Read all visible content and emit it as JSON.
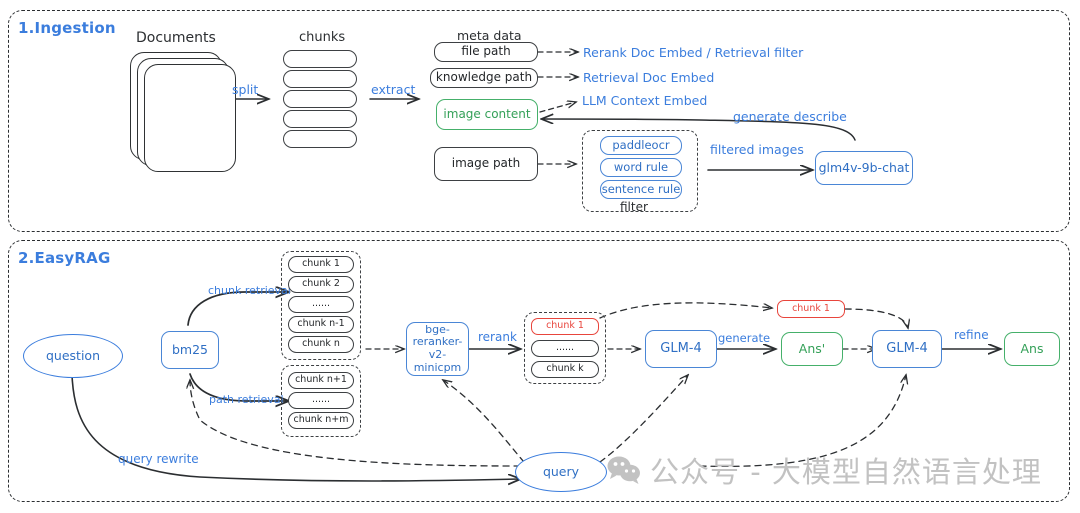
{
  "sections": [
    {
      "id": "ingestion",
      "title": "1.Ingestion"
    },
    {
      "id": "easyrag",
      "title": "2.EasyRAG"
    }
  ],
  "ingestion": {
    "group_labels": {
      "documents": "Documents",
      "chunks": "chunks",
      "meta_data": "meta data",
      "filter": "filter"
    },
    "arrow_labels": {
      "split": "split",
      "extract": "extract",
      "filtered_images": "filtered images",
      "generate_describe": "generate describe"
    },
    "meta_boxes": [
      {
        "label": "file path",
        "style": "gray"
      },
      {
        "label": "knowledge path",
        "style": "gray"
      },
      {
        "label": "image content",
        "style": "green"
      },
      {
        "label": "image path",
        "style": "gray"
      }
    ],
    "embed_targets": [
      "Rerank Doc Embed  / Retrieval filter",
      "Retrieval Doc Embed",
      "LLM Context Embed"
    ],
    "filter_rules": [
      "paddleocr",
      "word rule",
      "sentence rule"
    ],
    "vision_model": "glm4v-9b-chat"
  },
  "easyrag": {
    "question": "question",
    "bm25": "bm25",
    "reranker": "bge-\nreranker-v2-\nminicpm",
    "query": "query",
    "llm_generate": "GLM-4",
    "llm_refine": "GLM-4",
    "answer_draft": "Ans'",
    "answer_final": "Ans",
    "top_chunk": "chunk 1",
    "arrow_labels": {
      "chunk_retrieval": "chunk retrieval",
      "path_retrieval": "path retrieval",
      "rerank": "rerank",
      "generate": "generate",
      "refine": "refine",
      "query_rewrite": "query rewrite"
    },
    "chunk_group_top": [
      "chunk 1",
      "chunk 2",
      "......",
      "chunk n-1",
      "chunk n"
    ],
    "chunk_group_bottom": [
      "chunk n+1",
      "......",
      "chunk n+m"
    ],
    "reranked_chunks": [
      {
        "label": "chunk 1",
        "style": "red"
      },
      {
        "label": "......",
        "style": "gray"
      },
      {
        "label": "chunk k",
        "style": "gray"
      }
    ]
  },
  "watermark": {
    "text": "公众号 - 大模型自然语言处理"
  },
  "colors": {
    "accent_blue": "#3b7ddd",
    "green": "#34a058",
    "red": "#e8453c",
    "dark": "#2b2e31"
  }
}
